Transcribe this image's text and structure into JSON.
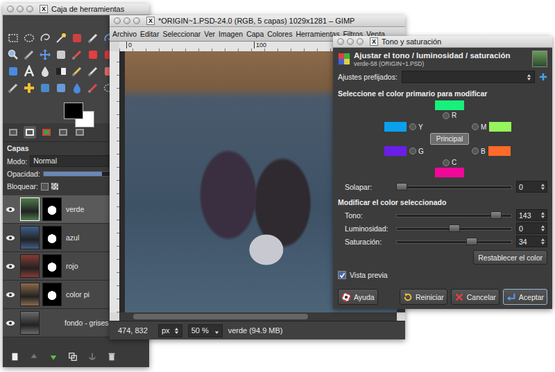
{
  "toolbox": {
    "title": "Caja de herramientas",
    "title_icon": "X",
    "layers_header": "Capas",
    "mode": {
      "label": "Modo:",
      "value": "Normal"
    },
    "opacity": {
      "label": "Opacidad:",
      "level": 0.6
    },
    "lock_label": "Bloquear:",
    "layers": [
      {
        "name": "verde",
        "visible": true,
        "selected": true,
        "has_mask": true,
        "color": "#4f7d4c"
      },
      {
        "name": "azul",
        "visible": true,
        "selected": false,
        "has_mask": true,
        "color": "#3f5f8a"
      },
      {
        "name": "rojo",
        "visible": true,
        "selected": false,
        "has_mask": true,
        "color": "#8a3a34"
      },
      {
        "name": "color pi",
        "visible": true,
        "selected": false,
        "has_mask": true,
        "color": "#8a6a4a"
      },
      {
        "name": "fondo - grises",
        "visible": true,
        "selected": false,
        "has_mask": false,
        "color": "#6a6a6a"
      }
    ]
  },
  "image_window": {
    "title": "*ORIGIN~1.PSD-24.0 (RGB, 5 capas) 1029x1281 – GIMP",
    "title_icon": "X",
    "menu": [
      "Archivo",
      "Editar",
      "Seleccionar",
      "Ver",
      "Imagen",
      "Capa",
      "Colores",
      "Herramientas",
      "Filtros",
      "Venta"
    ],
    "ruler_labels": [
      "0",
      "100"
    ],
    "status_bar": {
      "coords": "474, 832",
      "unit": "px",
      "zoom": "50 %",
      "layer_info": "verde (94.9 MB)"
    }
  },
  "dialog": {
    "title": "Tono y saturación",
    "title_icon": "X",
    "heading": "Ajustar el tono / luminosidad / saturación",
    "subheading": "verde-58 (ORIGIN~1.PSD)",
    "presets_label": "Ajustes prefijados:",
    "primaries_header": "Seleccione el color primario para modificar",
    "primaries": [
      {
        "label": "R",
        "color": "#18f07c",
        "selected": false
      },
      {
        "label": "Y",
        "color": "#0aa0f0",
        "selected": false
      },
      {
        "label": "M",
        "color": "#96f55a",
        "selected": false
      },
      {
        "label": "G",
        "color": "#6a1ee8",
        "selected": false
      },
      {
        "label": "B",
        "color": "#ff6a28",
        "selected": false
      },
      {
        "label": "C",
        "color": "#f0089a",
        "selected": false
      }
    ],
    "master": {
      "label": "Principal",
      "selected": true
    },
    "overlap": {
      "label": "Solapar:",
      "value": "0",
      "level": 0
    },
    "modify_header": "Modificar el color seleccionado",
    "adjustments": [
      {
        "label": "Tono:",
        "value": "143",
        "level": 0.9
      },
      {
        "label": "Luminosidad:",
        "value": "0",
        "level": 0.5
      },
      {
        "label": "Saturación:",
        "value": "34",
        "level": 0.67
      }
    ],
    "reset_color": "Restablecer el color",
    "preview": {
      "label": "Vista previa",
      "checked": true
    },
    "buttons": [
      {
        "label": "Ayuda",
        "default": false
      },
      {
        "label": "Reiniciar",
        "default": false
      },
      {
        "label": "Cancelar",
        "default": false
      },
      {
        "label": "Aceptar",
        "default": true
      }
    ]
  }
}
